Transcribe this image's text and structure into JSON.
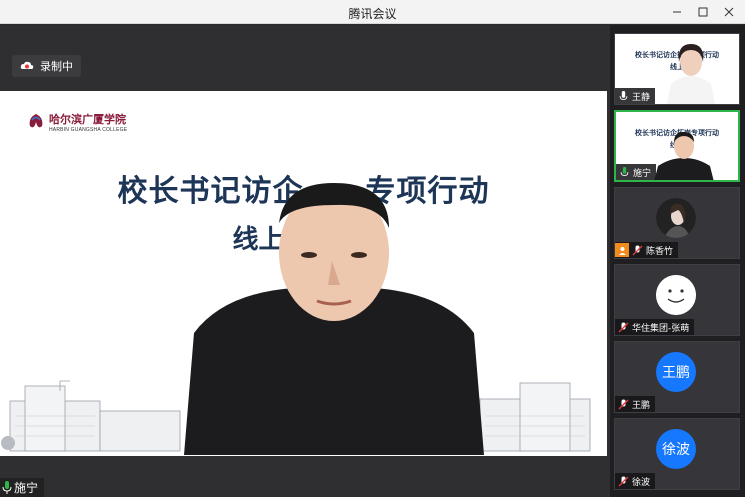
{
  "window": {
    "title": "腾讯会议"
  },
  "recording": {
    "label": "录制中"
  },
  "slide": {
    "logo_cn": "哈尔滨广厦学院",
    "logo_en": "HARBIN GUANGSHA COLLEGE",
    "title_visible": "校长书记访企",
    "title_tail": "专项行动",
    "subtitle_visible": "线上"
  },
  "main_speaker": {
    "name": "施宁"
  },
  "participants": [
    {
      "name": "王静",
      "type": "video-slide"
    },
    {
      "name": "施宁",
      "type": "video-slide",
      "active": true
    },
    {
      "name": "陈香竹",
      "type": "photo"
    },
    {
      "name": "华住集团-张萌",
      "type": "smile"
    },
    {
      "name": "王鹏",
      "type": "initials",
      "initials": "王鹏"
    },
    {
      "name": "徐波",
      "type": "initials",
      "initials": "徐波"
    }
  ],
  "tile_slide": {
    "line1": "校长书记访企拓岗专项行动",
    "line2": "线上"
  },
  "colors": {
    "accent": "#1677ff",
    "active_border": "#2fb54a",
    "brand": "#8a1c3b"
  },
  "icons": {
    "mic": "mic-icon",
    "mic_off": "mic-off-icon",
    "record": "record-cloud-icon"
  }
}
